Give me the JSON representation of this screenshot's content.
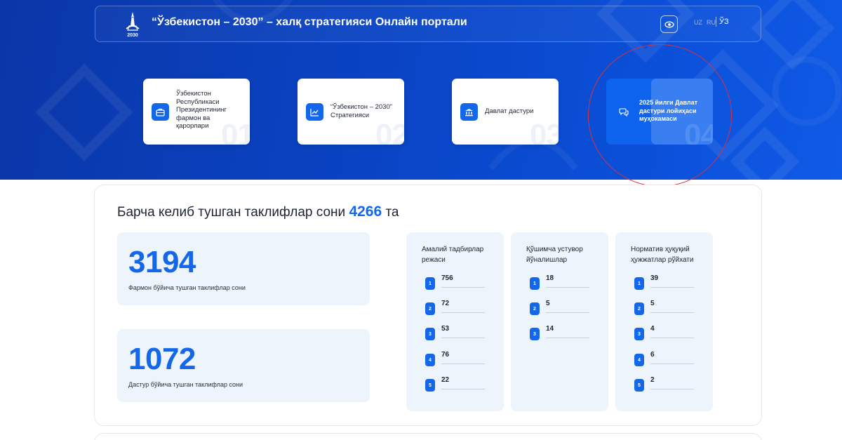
{
  "header": {
    "logo_year": "2030",
    "title": "“Ўзбекистон – 2030” – халқ стратегияси Онлайн портали",
    "languages": [
      "UZ",
      "RU",
      "ЎЗ"
    ],
    "active_language": "ЎЗ"
  },
  "cards": [
    {
      "number": "01",
      "icon": "briefcase-icon",
      "label": [
        "Ўзбекистон",
        "Республикаси",
        "Президентининг",
        "фармон ва",
        "қарорлари"
      ]
    },
    {
      "number": "02",
      "icon": "chart-icon",
      "label": [
        "“Ўзбекистон – 2030”",
        "Стратегияси"
      ]
    },
    {
      "number": "03",
      "icon": "bank-icon",
      "label": [
        "Давлат дастури"
      ]
    },
    {
      "number": "04",
      "icon": "chat-icon",
      "label": [
        "2025 йилги Давлат",
        "дастури лойиҳаси",
        "муҳокамаси"
      ]
    }
  ],
  "summary": {
    "prefix": "Барча келиб тушган таклифлар сони",
    "total": "4266",
    "suffix": "та"
  },
  "stats": [
    {
      "value": "3194",
      "caption": "Фармон бўйича тушган таклифлар сони"
    },
    {
      "value": "1072",
      "caption": "Дастур бўйича тушган таклифлар сони"
    }
  ],
  "columns": [
    {
      "title": "Амалий тадбирлар режаси",
      "rows": [
        {
          "n": "1",
          "v": "756"
        },
        {
          "n": "2",
          "v": "72"
        },
        {
          "n": "3",
          "v": "53"
        },
        {
          "n": "4",
          "v": "76"
        },
        {
          "n": "5",
          "v": "22"
        }
      ]
    },
    {
      "title": "Қўшимча устувор йўналишлар",
      "rows": [
        {
          "n": "1",
          "v": "18"
        },
        {
          "n": "2",
          "v": "5"
        },
        {
          "n": "3",
          "v": "14"
        }
      ]
    },
    {
      "title": "Норматив ҳуқуқий ҳужжатлар рўйхати",
      "rows": [
        {
          "n": "1",
          "v": "39"
        },
        {
          "n": "2",
          "v": "5"
        },
        {
          "n": "3",
          "v": "4"
        },
        {
          "n": "4",
          "v": "6"
        },
        {
          "n": "5",
          "v": "2"
        }
      ]
    }
  ],
  "colors": {
    "primary": "#1467e8",
    "hero": "#0a44c4",
    "annotation": "#e0303a"
  }
}
